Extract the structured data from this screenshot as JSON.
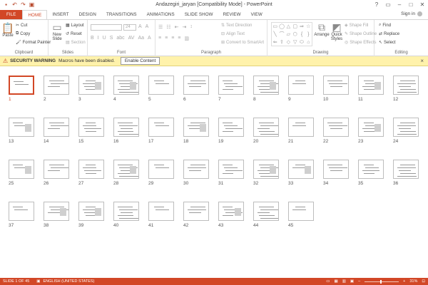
{
  "window": {
    "title": "Andazegiri_jaryan [Compatibility Mode] - PowerPoint",
    "qat_icons": [
      "save-icon",
      "undo-icon",
      "redo-icon",
      "start-slideshow-icon"
    ],
    "controls": [
      "?",
      "▭",
      "–",
      "□",
      "✕"
    ]
  },
  "tabs": [
    "FILE",
    "HOME",
    "INSERT",
    "DESIGN",
    "TRANSITIONS",
    "ANIMATIONS",
    "SLIDE SHOW",
    "REVIEW",
    "VIEW"
  ],
  "active_tab": "HOME",
  "signin": "Sign in",
  "ribbon": {
    "clipboard": {
      "paste": "Paste",
      "cut": "Cut",
      "copy": "Copy",
      "format_painter": "Format Painter",
      "label": "Clipboard"
    },
    "slides": {
      "new_slide": "New",
      "new_slide2": "Slide",
      "layout": "Layout",
      "reset": "Reset",
      "section": "Section",
      "label": "Slides"
    },
    "font": {
      "size": "24",
      "label": "Font",
      "format_glyphs": [
        "B",
        "I",
        "U",
        "S",
        "abc",
        "AV",
        "Aa",
        "A"
      ]
    },
    "paragraph": {
      "text_direction": "Text Direction",
      "align_text": "Align Text",
      "convert_smartart": "Convert to SmartArt",
      "label": "Paragraph"
    },
    "drawing": {
      "arrange": "Arrange",
      "quick_styles": "Quick",
      "quick_styles2": "Styles",
      "shape_fill": "Shape Fill",
      "shape_outline": "Shape Outline",
      "shape_effects": "Shape Effects",
      "label": "Drawing",
      "shape_glyphs": [
        "▭",
        "◯",
        "△",
        "▢",
        "⇒",
        "☆",
        "╲",
        "⌒",
        "▱",
        "⬡",
        "{",
        "}",
        "⇐",
        "⇧",
        "◇",
        "▽",
        "⬭",
        "⌂"
      ]
    },
    "editing": {
      "find": "Find",
      "replace": "Replace",
      "select": "Select",
      "label": "Editing"
    }
  },
  "security": {
    "title": "SECURITY WARNING",
    "message": "Macros have been disabled.",
    "button": "Enable Content"
  },
  "slides": {
    "selected": 1,
    "numbers": [
      "1",
      "2",
      "3",
      "4",
      "5",
      "6",
      "7",
      "8",
      "9",
      "10",
      "11",
      "12",
      "13",
      "14",
      "15",
      "16",
      "17",
      "18",
      "19",
      "20",
      "21",
      "22",
      "23",
      "24",
      "25",
      "26",
      "27",
      "28",
      "29",
      "30",
      "31",
      "32",
      "33",
      "34",
      "35",
      "36",
      "37",
      "38",
      "39",
      "40",
      "41",
      "42",
      "43",
      "44",
      "45"
    ]
  },
  "status": {
    "slide_info": "SLIDE 1 OF 45",
    "language": "ENGLISH (UNITED STATES)",
    "zoom": "31%"
  },
  "colors": {
    "accent": "#d24726",
    "warning_bg": "#fff2ab"
  }
}
